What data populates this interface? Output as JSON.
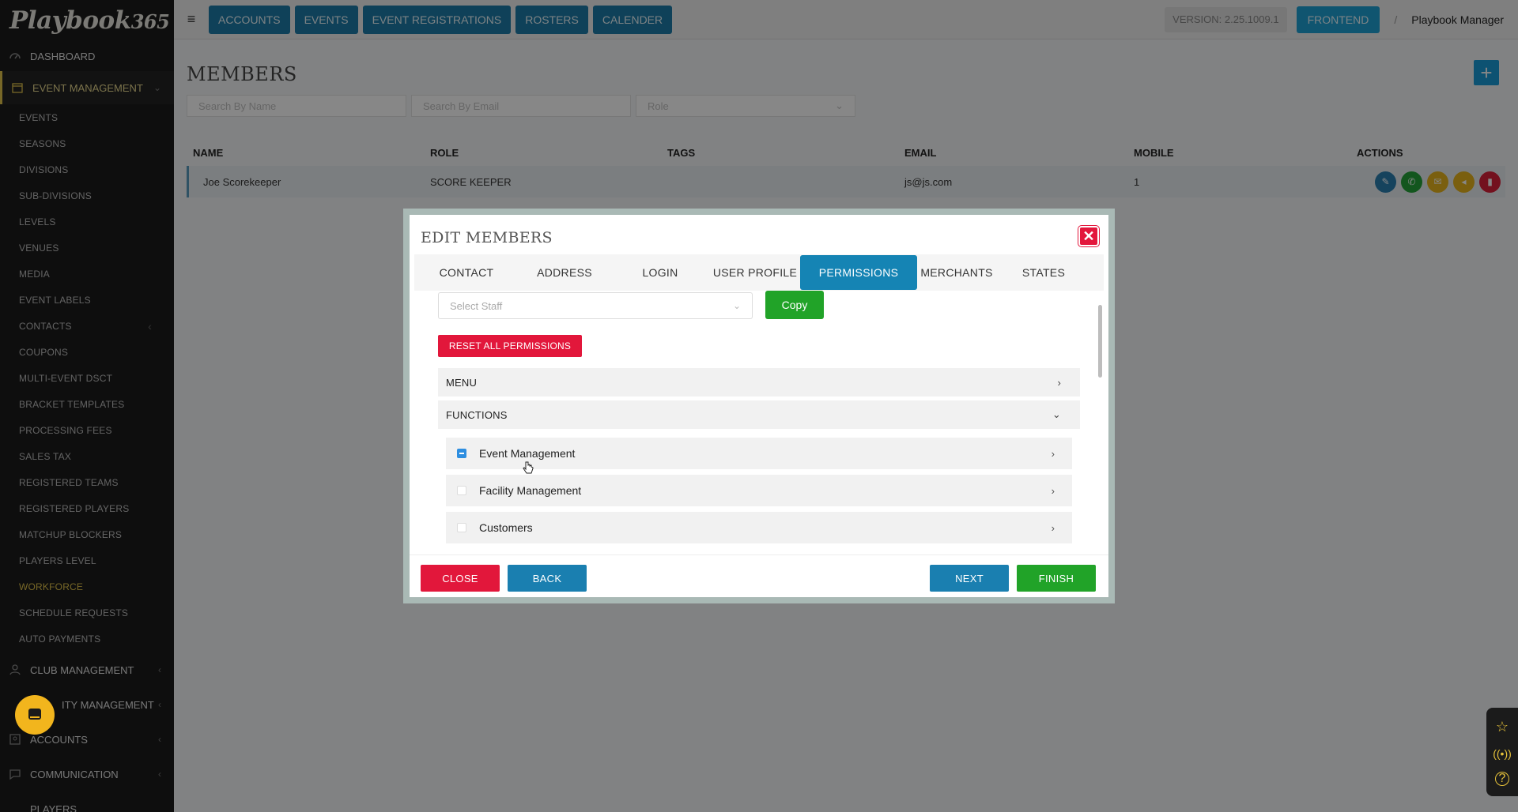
{
  "logo": {
    "main": "Playbook",
    "suffix": "365"
  },
  "sidebar": {
    "dashboard": "DASHBOARD",
    "event_management": "EVENT MANAGEMENT",
    "sub_items": [
      "EVENTS",
      "SEASONS",
      "DIVISIONS",
      "SUB-DIVISIONS",
      "LEVELS",
      "VENUES",
      "MEDIA",
      "EVENT LABELS",
      "CONTACTS",
      "COUPONS",
      "MULTI-EVENT DSCT",
      "BRACKET TEMPLATES",
      "PROCESSING FEES",
      "SALES TAX",
      "REGISTERED TEAMS",
      "REGISTERED PLAYERS",
      "MATCHUP BLOCKERS",
      "PLAYERS LEVEL",
      "WORKFORCE",
      "SCHEDULE REQUESTS",
      "AUTO PAYMENTS"
    ],
    "club_management": "CLUB MANAGEMENT",
    "facility_management": "ITY MANAGEMENT",
    "accounts": "ACCOUNTS",
    "communication": "COMMUNICATION",
    "players": "PLAYERS"
  },
  "topbar": {
    "buttons": [
      "ACCOUNTS",
      "EVENTS",
      "EVENT REGISTRATIONS",
      "ROSTERS",
      "CALENDER"
    ],
    "version": "VERSION: 2.25.1009.1",
    "frontend": "FRONTEND",
    "separator": "/",
    "user": "Playbook Manager"
  },
  "page": {
    "title": "MEMBERS",
    "filters": {
      "name": "Search By Name",
      "email": "Search By Email",
      "role": "Role"
    },
    "columns": [
      "NAME",
      "ROLE",
      "TAGS",
      "EMAIL",
      "MOBILE",
      "ACTIONS"
    ],
    "row": {
      "name": "Joe Scorekeeper",
      "role": "SCORE KEEPER",
      "tags": "",
      "email": "js@js.com",
      "mobile": "1"
    }
  },
  "modal": {
    "title": "EDIT MEMBERS",
    "tabs": [
      "CONTACT",
      "ADDRESS",
      "LOGIN",
      "USER PROFILE",
      "PERMISSIONS",
      "MERCHANTS",
      "STATES"
    ],
    "active_tab": "PERMISSIONS",
    "select_staff_placeholder": "Select Staff",
    "copy_label": "Copy",
    "reset_label": "RESET ALL PERMISSIONS",
    "sections": {
      "menu": "MENU",
      "functions": "FUNCTIONS"
    },
    "permissions": [
      {
        "label": "Event Management",
        "state": "partial"
      },
      {
        "label": "Facility Management",
        "state": "unchecked"
      },
      {
        "label": "Customers",
        "state": "unchecked"
      }
    ],
    "footer": {
      "close": "CLOSE",
      "back": "BACK",
      "next": "NEXT",
      "finish": "FINISH"
    }
  },
  "colors": {
    "primary": "#1d7ca8",
    "danger": "#e2173b",
    "success": "#21a328",
    "accent": "#e0c24a"
  }
}
